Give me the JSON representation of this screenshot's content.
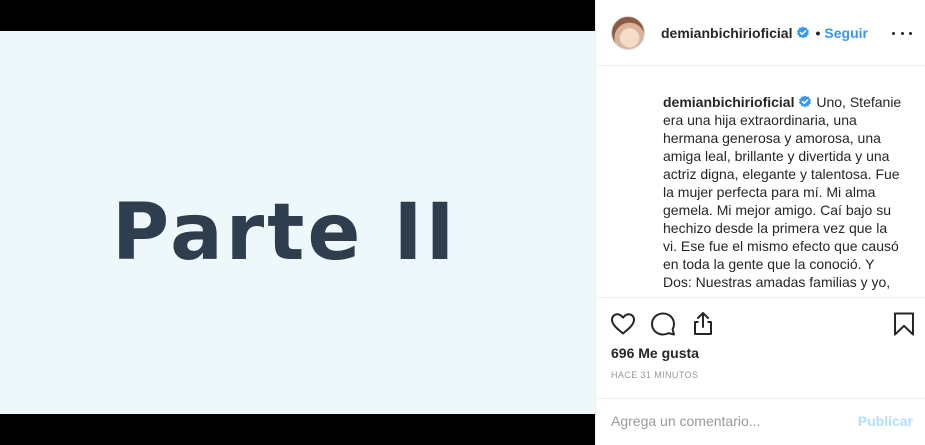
{
  "media": {
    "text": "Parte II"
  },
  "header": {
    "username": "demianbichirioficial",
    "separator": "•",
    "follow_label": "Seguir"
  },
  "caption": {
    "username": "demianbichirioficial",
    "text": "Uno, Stefanie era una hija extraordinaria, una hermana generosa y amorosa, una amiga leal, brillante y divertida y una actriz digna, elegante y talentosa. Fue la mujer perfecta para mí. Mi alma gemela. Mi mejor amigo. Caí bajo su hechizo desde la primera vez que la vi. Ese fue el mismo efecto que causó en toda la gente que la conoció. Y Dos: Nuestras amadas familias y yo,"
  },
  "stats": {
    "likes": "696 Me gusta",
    "time": "HACE 31 MINUTOS"
  },
  "comment": {
    "placeholder": "Agrega un comentario...",
    "publish_label": "Publicar"
  },
  "icons": {
    "verified": "verified-badge-icon",
    "more": "more-options-icon",
    "like": "heart-icon",
    "comment": "comment-bubble-icon",
    "share": "share-icon",
    "save": "bookmark-icon"
  },
  "colors": {
    "accent": "#3897f0",
    "publish_disabled": "#b2dffc",
    "image_background": "#eef7f9",
    "image_text": "#2f3e4e"
  }
}
